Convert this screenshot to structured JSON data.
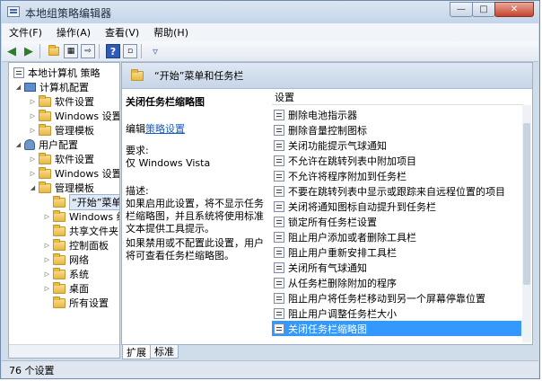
{
  "window": {
    "title": "本地组策略编辑器"
  },
  "menu": [
    "文件(F)",
    "操作(A)",
    "查看(V)",
    "帮助(H)"
  ],
  "tree": {
    "root": "本地计算机 策略",
    "items": [
      {
        "label": "计算机配置"
      },
      {
        "label": "软件设置"
      },
      {
        "label": "Windows 设置"
      },
      {
        "label": "管理模板"
      },
      {
        "label": "用户配置"
      },
      {
        "label": "软件设置"
      },
      {
        "label": "Windows 设置"
      },
      {
        "label": "管理模板"
      },
      {
        "label": "“开始”菜单"
      },
      {
        "label": "Windows 组"
      },
      {
        "label": "共享文件夹"
      },
      {
        "label": "控制面板"
      },
      {
        "label": "网络"
      },
      {
        "label": "系统"
      },
      {
        "label": "桌面"
      },
      {
        "label": "所有设置"
      }
    ]
  },
  "header": {
    "title": "“开始”菜单和任务栏"
  },
  "description": {
    "title": "关闭任务栏缩略图",
    "edit_prefix": "编辑",
    "edit_link": "策略设置",
    "req_label": "要求:",
    "req_value": "仅 Windows Vista",
    "desc_label": "描述:",
    "desc_text": "如果启用此设置，将不显示任务栏缩略图，并且系统将使用标准文本提供工具提示。",
    "desc_more": "如果禁用或不配置此设置，用户将可查看任务栏缩略图。"
  },
  "list": {
    "column": "设置",
    "items": [
      "删除电池指示器",
      "删除音量控制图标",
      "关闭功能提示气球通知",
      "不允许在跳转列表中附加项目",
      "不允许将程序附加到任务栏",
      "不要在跳转列表中显示或跟踪来自远程位置的项目",
      "关闭将通知图标自动提升到任务栏",
      "锁定所有任务栏设置",
      "阻止用户添加或者删除工具栏",
      "阻止用户重新安排工具栏",
      "关闭所有气球通知",
      "从任务栏删除附加的程序",
      "阻止用户将任务栏移动到另一个屏幕停靠位置",
      "阻止用户调整任务栏大小",
      "关闭任务栏缩略图"
    ],
    "selected_index": 14
  },
  "tabs": [
    "扩展",
    "标准"
  ],
  "status": "76 个设置"
}
